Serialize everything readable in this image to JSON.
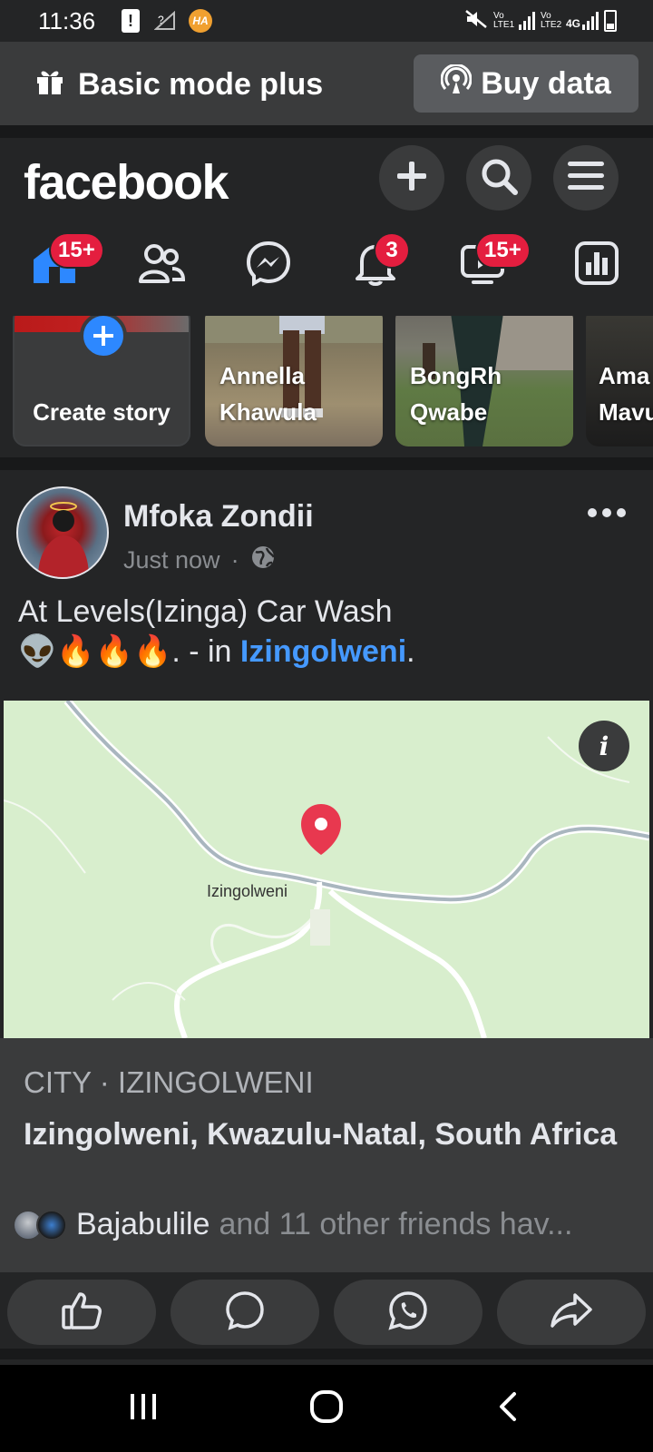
{
  "status_bar": {
    "time": "11:36",
    "alert_icon": "!",
    "ha_badge": "HA",
    "sim1_label": "Vo LTE1",
    "sim2_label": "Vo LTE2",
    "network_type": "4G"
  },
  "mode_bar": {
    "label": "Basic mode plus",
    "buy_button": "Buy data",
    "gift_icon": "gift-icon",
    "broadcast_icon": "broadcast-icon"
  },
  "header": {
    "logo": "facebook",
    "buttons": [
      "add-icon",
      "search-icon",
      "menu-icon"
    ]
  },
  "nav": {
    "home_badge": "15+",
    "notifications_badge": "3",
    "video_badge": "15+"
  },
  "stories": {
    "create_label": "Create story",
    "items": [
      {
        "name": "Annella Khawula",
        "line1": "Annella",
        "line2": "Khawula"
      },
      {
        "name": "BongRh Qwabe",
        "line1": "BongRh",
        "line2": "Qwabe"
      },
      {
        "name": "Ama Mavu",
        "line1": "Ama",
        "line2": "Mavu"
      }
    ]
  },
  "post": {
    "author": "Mfoka Zondii",
    "time": "Just now",
    "text_line1": "At Levels(Izinga) Car Wash",
    "emojis": "👽🔥🔥🔥",
    "text_suffix": ". - in ",
    "location_link": "Izingolweni",
    "text_end": ".",
    "map": {
      "town_label": "Izingolweni",
      "info_label": "i"
    },
    "place": {
      "category": "CITY · IZINGOLWENI",
      "name": "Izingolweni, Kwazulu-Natal, South Africa",
      "friend_name": "Bajabulile",
      "friends_rest": "and 11 other friends hav..."
    }
  },
  "colors": {
    "background": "#242526",
    "surface": "#3a3b3c",
    "accent": "#2d88ff",
    "link": "#4599ff",
    "badge": "#e41e3f",
    "map": "#d8eecd",
    "pin": "#e8384f"
  }
}
